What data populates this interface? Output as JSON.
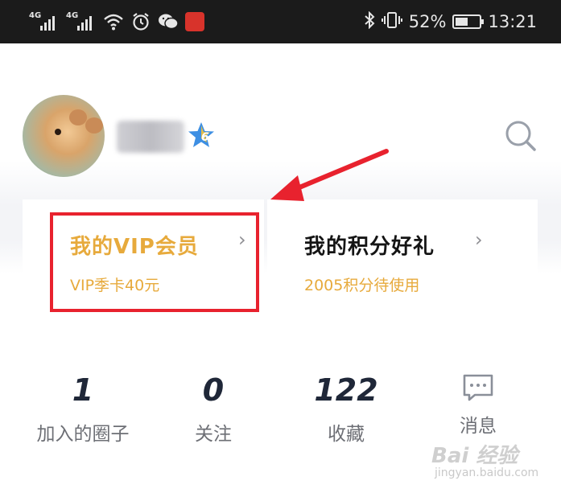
{
  "status_bar": {
    "network_tag_1": "4G",
    "network_tag_2": "4G",
    "signal_level": 1.0,
    "battery_percent": "52%",
    "battery_level": 0.52,
    "time": "13:21",
    "app_notification_icon": "jd-app-icon"
  },
  "profile": {
    "avatar": "hamster-avatar",
    "level": "6",
    "search_icon": "search-icon"
  },
  "cards": {
    "vip": {
      "title": "我的VIP会员",
      "subtitle": "VIP季卡40元",
      "chevron": "›"
    },
    "points": {
      "title": "我的积分好礼",
      "subtitle": "2005积分待使用",
      "chevron": "›"
    }
  },
  "stats": [
    {
      "value": "1",
      "label": "加入的圈子"
    },
    {
      "value": "0",
      "label": "关注"
    },
    {
      "value": "122",
      "label": "收藏"
    },
    {
      "value": "",
      "label": "消息"
    }
  ],
  "watermark": {
    "main": "Bai 经验",
    "sub": "jingyan.baidu.com"
  },
  "colors": {
    "accent_gold": "#e7aa3c",
    "highlight_red": "#e8222e",
    "stat_number": "#1f2738"
  }
}
